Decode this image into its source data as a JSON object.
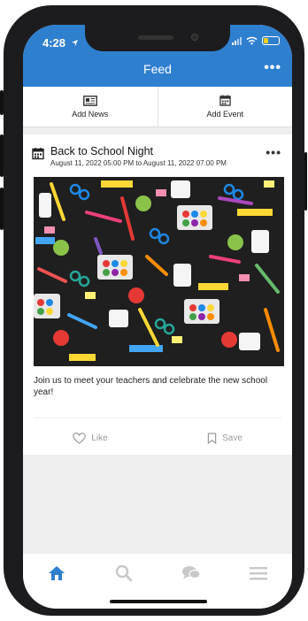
{
  "status": {
    "time": "4:28"
  },
  "header": {
    "title": "Feed"
  },
  "actions": [
    {
      "label": "Add News",
      "icon": "newspaper-icon"
    },
    {
      "label": "Add Event",
      "icon": "calendar-icon"
    }
  ],
  "post": {
    "title": "Back to School Night",
    "date": "August 11, 2022 05:00 PM to August 11, 2022 07:00 PM",
    "body": "Join us to meet your teachers and celebrate the new school year!",
    "like_label": "Like",
    "save_label": "Save"
  },
  "nav": [
    {
      "icon": "home-icon",
      "active": true
    },
    {
      "icon": "search-icon",
      "active": false
    },
    {
      "icon": "chat-icon",
      "active": false
    },
    {
      "icon": "menu-icon",
      "active": false
    }
  ],
  "colors": {
    "accent": "#2f7fcf",
    "inactive": "#c8c8c8",
    "image_bg": "#1f1f1f"
  }
}
